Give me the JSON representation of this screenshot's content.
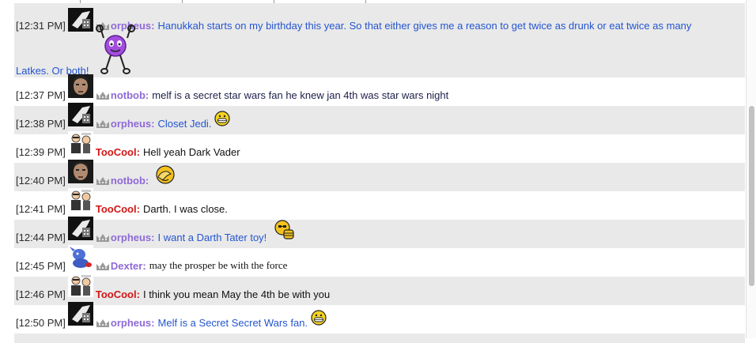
{
  "chat": {
    "messages": [
      {
        "time": "[12:31 PM]",
        "user": "orpheus",
        "text_line1": "Hanukkah starts on my birthday this year. So that either gives me a reason to get twice as drunk or eat twice as many",
        "text_line2": "Latkes. Or both!",
        "avatar": "orpheus-avatar",
        "badge": "crown-icon",
        "emote": "dancing-purple-smiley"
      },
      {
        "time": "[12:37 PM]",
        "user": "notbob",
        "text": "melf is a secret star wars fan he knew jan 4th was star wars night",
        "avatar": "notbob-avatar",
        "badge": "crown-icon"
      },
      {
        "time": "[12:38 PM]",
        "user": "orpheus",
        "text": "Closet Jedi.",
        "avatar": "orpheus-avatar",
        "badge": "crown-icon",
        "emote": "grin-smiley"
      },
      {
        "time": "[12:39 PM]",
        "user": "TooCool",
        "text": "Hell yeah Dark Vader",
        "avatar": "toocool-avatar"
      },
      {
        "time": "[12:40 PM]",
        "user": "notbob",
        "text": "",
        "avatar": "notbob-avatar",
        "badge": "crown-icon",
        "emote": "facepalm-smiley"
      },
      {
        "time": "[12:41 PM]",
        "user": "TooCool",
        "text": "Darth. I was close.",
        "avatar": "toocool-avatar"
      },
      {
        "time": "[12:44 PM]",
        "user": "orpheus",
        "text": "I want a Darth Tater toy!",
        "avatar": "orpheus-avatar",
        "badge": "crown-icon",
        "emote": "thumbs-up-smiley"
      },
      {
        "time": "[12:45 PM]",
        "user": "Dexter",
        "text": "may the prosper be with the force",
        "avatar": "dexter-avatar",
        "badge": "crown-icon"
      },
      {
        "time": "[12:46 PM]",
        "user": "TooCool",
        "text": "I think you mean May the 4th be with you",
        "avatar": "toocool-avatar"
      },
      {
        "time": "[12:50 PM]",
        "user": "orpheus",
        "text": "Melf is a Secret Secret Wars fan.",
        "avatar": "orpheus-avatar",
        "badge": "crown-icon",
        "emote": "grin-smiley"
      }
    ]
  },
  "colors": {
    "mod_name": "#8e6ad6",
    "toocool_name": "#d31616",
    "orpheus_text": "#2455cf",
    "alt_row_bg": "#e9e9e9"
  }
}
